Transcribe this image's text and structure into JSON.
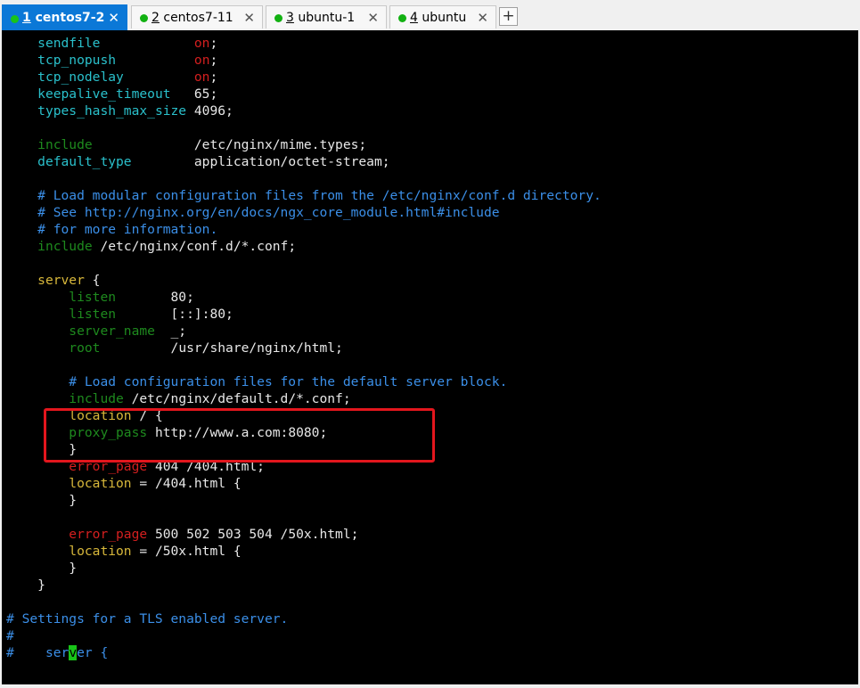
{
  "tabs": [
    {
      "num": "1",
      "label": "centos7-2",
      "close": "✕"
    },
    {
      "num": "2",
      "label": "centos7-11",
      "close": "✕"
    },
    {
      "num": "3",
      "label": "ubuntu-1",
      "close": "✕"
    },
    {
      "num": "4",
      "label": "ubuntu",
      "close": "✕"
    }
  ],
  "new_tab_label": "+",
  "terminal": {
    "lines": [
      [
        {
          "t": "    "
        },
        {
          "t": "sendfile",
          "c": "kw"
        },
        {
          "t": "            "
        },
        {
          "t": "on",
          "c": "red"
        },
        {
          "t": ";"
        }
      ],
      [
        {
          "t": "    "
        },
        {
          "t": "tcp_nopush",
          "c": "kw"
        },
        {
          "t": "          "
        },
        {
          "t": "on",
          "c": "red"
        },
        {
          "t": ";"
        }
      ],
      [
        {
          "t": "    "
        },
        {
          "t": "tcp_nodelay",
          "c": "kw"
        },
        {
          "t": "         "
        },
        {
          "t": "on",
          "c": "red"
        },
        {
          "t": ";"
        }
      ],
      [
        {
          "t": "    "
        },
        {
          "t": "keepalive_timeout",
          "c": "kw"
        },
        {
          "t": "   65;"
        }
      ],
      [
        {
          "t": "    "
        },
        {
          "t": "types_hash_max_size",
          "c": "kw"
        },
        {
          "t": " 4096;"
        }
      ],
      [],
      [
        {
          "t": "    "
        },
        {
          "t": "include",
          "c": "grn"
        },
        {
          "t": "             /etc/nginx/mime.types;"
        }
      ],
      [
        {
          "t": "    "
        },
        {
          "t": "default_type",
          "c": "kw"
        },
        {
          "t": "        application/octet-stream;"
        }
      ],
      [],
      [
        {
          "t": "    "
        },
        {
          "t": "# Load modular configuration files from the /etc/nginx/conf.d directory.",
          "c": "com"
        }
      ],
      [
        {
          "t": "    "
        },
        {
          "t": "# See http://nginx.org/en/docs/ngx_core_module.html#include",
          "c": "com"
        }
      ],
      [
        {
          "t": "    "
        },
        {
          "t": "# for more information.",
          "c": "com"
        }
      ],
      [
        {
          "t": "    "
        },
        {
          "t": "include",
          "c": "grn"
        },
        {
          "t": " /etc/nginx/conf.d/*.conf;"
        }
      ],
      [],
      [
        {
          "t": "    "
        },
        {
          "t": "server",
          "c": "yel"
        },
        {
          "t": " {"
        }
      ],
      [
        {
          "t": "        "
        },
        {
          "t": "listen",
          "c": "grn"
        },
        {
          "t": "       80;"
        }
      ],
      [
        {
          "t": "        "
        },
        {
          "t": "listen",
          "c": "grn"
        },
        {
          "t": "       [::]:80;"
        }
      ],
      [
        {
          "t": "        "
        },
        {
          "t": "server_name",
          "c": "grn"
        },
        {
          "t": "  _;"
        }
      ],
      [
        {
          "t": "        "
        },
        {
          "t": "root",
          "c": "grn"
        },
        {
          "t": "         /usr/share/nginx/html;"
        }
      ],
      [],
      [
        {
          "t": "        "
        },
        {
          "t": "# Load configuration files for the default server block.",
          "c": "com"
        }
      ],
      [
        {
          "t": "        "
        },
        {
          "t": "include",
          "c": "grn"
        },
        {
          "t": " /etc/nginx/default.d/*.conf;"
        }
      ],
      [
        {
          "t": "        "
        },
        {
          "t": "location",
          "c": "yel"
        },
        {
          "t": " / {"
        }
      ],
      [
        {
          "t": "        "
        },
        {
          "t": "proxy_pass",
          "c": "grn"
        },
        {
          "t": " http://www.a.com:8080;"
        }
      ],
      [
        {
          "t": "        }"
        }
      ],
      [
        {
          "t": "        "
        },
        {
          "t": "error_page",
          "c": "red"
        },
        {
          "t": " 404 /404.html;"
        }
      ],
      [
        {
          "t": "        "
        },
        {
          "t": "location",
          "c": "yel"
        },
        {
          "t": " = /404.html {"
        }
      ],
      [
        {
          "t": "        }"
        }
      ],
      [],
      [
        {
          "t": "        "
        },
        {
          "t": "error_page",
          "c": "red"
        },
        {
          "t": " 500 502 503 504 /50x.html;"
        }
      ],
      [
        {
          "t": "        "
        },
        {
          "t": "location",
          "c": "yel"
        },
        {
          "t": " = /50x.html {"
        }
      ],
      [
        {
          "t": "        }"
        }
      ],
      [
        {
          "t": "    }"
        }
      ],
      [],
      [
        {
          "t": "# Settings for a TLS enabled server.",
          "c": "com"
        }
      ],
      [
        {
          "t": "#",
          "c": "com"
        }
      ],
      [
        {
          "t": "#",
          "c": "com"
        },
        {
          "t": "    "
        },
        {
          "t": "ser",
          "c": "com"
        },
        {
          "t": "v",
          "c": "cur"
        },
        {
          "t": "er {",
          "c": "com"
        }
      ]
    ]
  },
  "colors": {
    "active_tab": "#0b78d7",
    "status_dot": "#12b112",
    "highlight_box": "#e3161d",
    "terminal_bg": "#000000"
  }
}
